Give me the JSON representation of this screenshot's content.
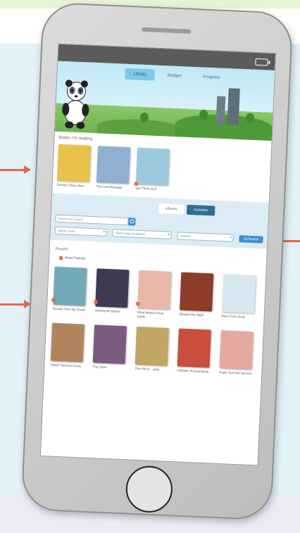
{
  "app": {
    "nav_tabs": [
      {
        "label": "Library",
        "active": true
      },
      {
        "label": "Badges",
        "active": false
      },
      {
        "label": "Progress",
        "active": false
      }
    ]
  },
  "featured": {
    "section_label": "Books I'm reading",
    "books": [
      {
        "title": "Sunny's Story Hero",
        "color": "#e8c24a"
      },
      {
        "title": "The Lost Message",
        "color": "#8fb0cf"
      },
      {
        "title": "Get Them Out!",
        "color": "#9dc9dd"
      }
    ]
  },
  "filter": {
    "toggle": [
      {
        "label": "eBooks",
        "active": false
      },
      {
        "label": "Activities",
        "active": true
      }
    ],
    "search_placeholder": "Search for a book",
    "selects": [
      "Select Level",
      "Select Age Guidance",
      "Genres"
    ],
    "go_label": "Go/Search"
  },
  "results": {
    "label": "Results",
    "sort_label": "Most Popular"
  },
  "library_grid": [
    {
      "title": "Escape from the Tower",
      "color": "#74a9b8"
    },
    {
      "title": "Among the Bones",
      "color": "#3e3a52"
    },
    {
      "title": "What Makes Great Chefs",
      "color": "#e9b6a8"
    },
    {
      "title": "Beware the Night",
      "color": "#8b3d2a"
    },
    {
      "title": "Back From Away",
      "color": "#d9e7f1"
    },
    {
      "title": "Desert Survival Guide",
      "color": "#b0855e"
    },
    {
      "title": "The Cube",
      "color": "#7a5d7e"
    },
    {
      "title": "The Girl in... Jack",
      "color": "#c0a766"
    },
    {
      "title": "Ultimate Survival Book",
      "color": "#c94e3d"
    },
    {
      "title": "Super Survival Secrets",
      "color": "#e6a9a0"
    }
  ],
  "colors": {
    "accent": "#e8664b",
    "primary_blue": "#3d8fd1",
    "toggle_active": "#2f6e92"
  }
}
